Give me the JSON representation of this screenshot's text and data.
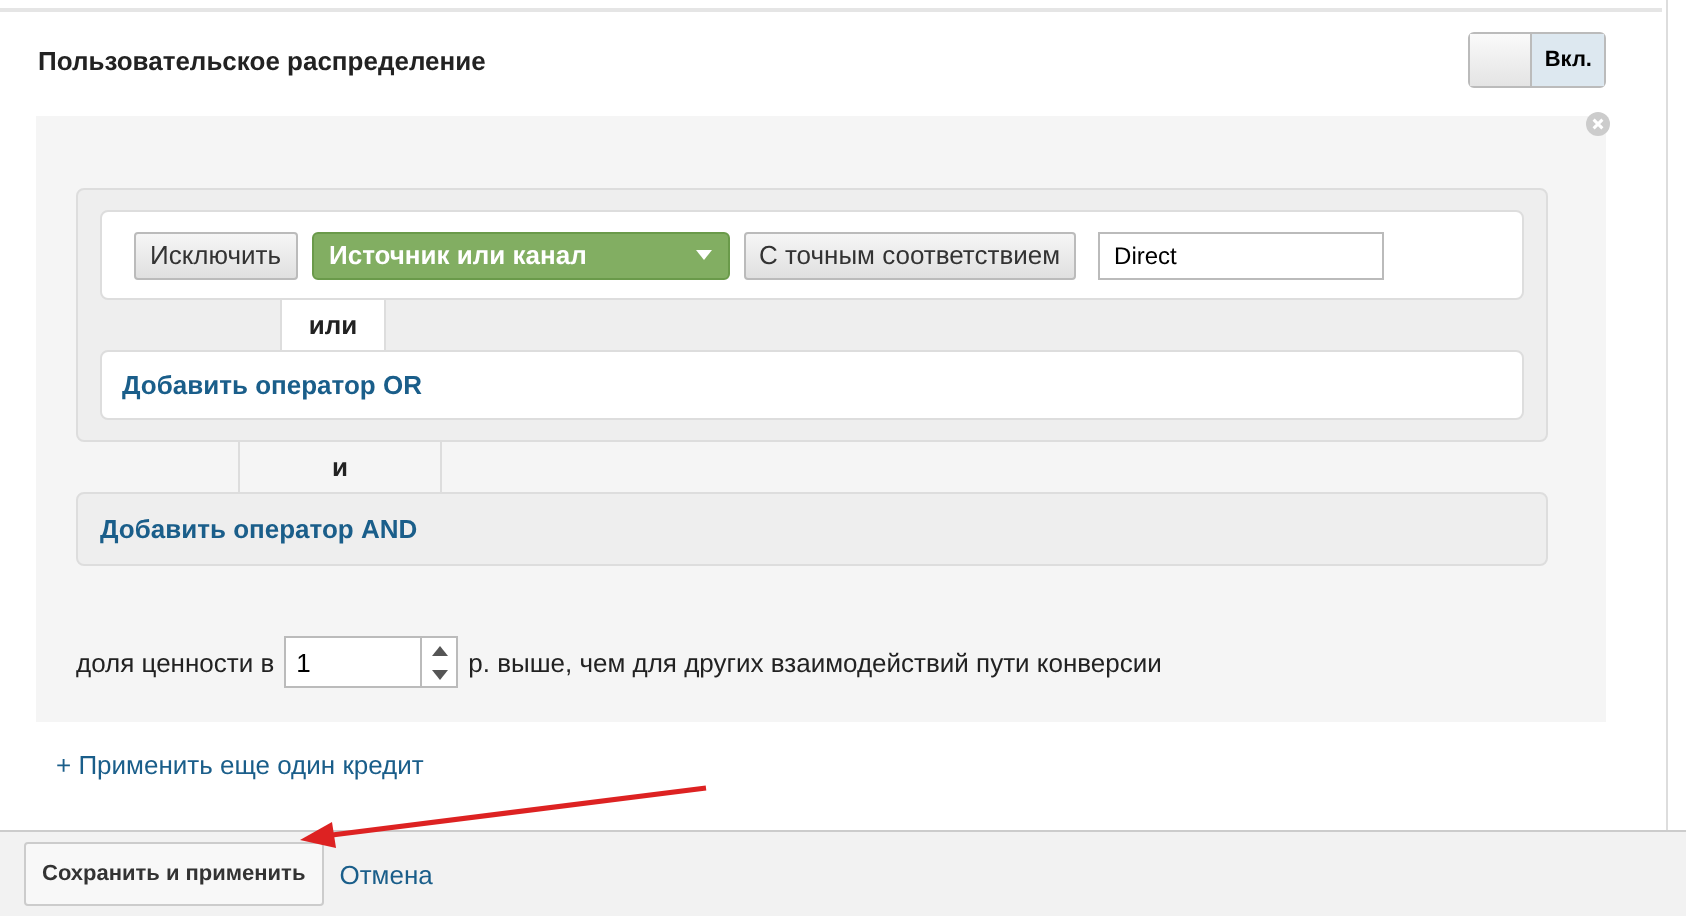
{
  "header": {
    "title": "Пользовательское распределение",
    "toggle": {
      "label": "Вкл.",
      "on": true
    }
  },
  "condition": {
    "exclude_button": "Исключить",
    "dimension": "Источник или канал",
    "match_button": "С точным соответствием",
    "value": "Direct"
  },
  "or_label": "или",
  "add_or": "Добавить оператор OR",
  "and_label": "и",
  "add_and": "Добавить оператор AND",
  "credit": {
    "prefix": "доля ценности в",
    "value": "1",
    "suffix": "р. выше, чем для других взаимодействий пути конверсии"
  },
  "add_credit": "+ Применить еще один кредит",
  "footer": {
    "save": "Сохранить и применить",
    "cancel": "Отмена"
  }
}
